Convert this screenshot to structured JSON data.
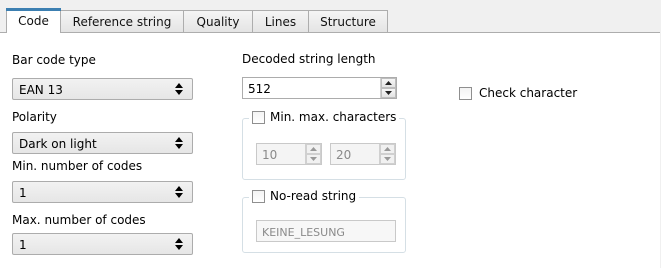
{
  "tabs": [
    {
      "label": "Code"
    },
    {
      "label": "Reference string"
    },
    {
      "label": "Quality"
    },
    {
      "label": "Lines"
    },
    {
      "label": "Structure"
    }
  ],
  "left": {
    "barcode_type": {
      "label": "Bar code type",
      "value": "EAN 13"
    },
    "polarity": {
      "label": "Polarity",
      "value": "Dark on light"
    },
    "min_codes": {
      "label": "Min. number of codes",
      "value": "1"
    },
    "max_codes": {
      "label": "Max. number of codes",
      "value": "1"
    }
  },
  "middle": {
    "decoded_length": {
      "label": "Decoded string length",
      "value": "512"
    },
    "minmax_group": {
      "label": "Min. max. characters",
      "checked": false,
      "min_value": "10",
      "max_value": "20"
    },
    "noread_group": {
      "label": "No-read string",
      "checked": false,
      "value": "KEINE_LESUNG"
    }
  },
  "right": {
    "check_character": {
      "label": "Check character",
      "checked": false
    }
  },
  "colors": {
    "active_tab_accent": "#3c7fb1",
    "panel_background": "#ffffff",
    "window_background": "#f0f0f0"
  }
}
